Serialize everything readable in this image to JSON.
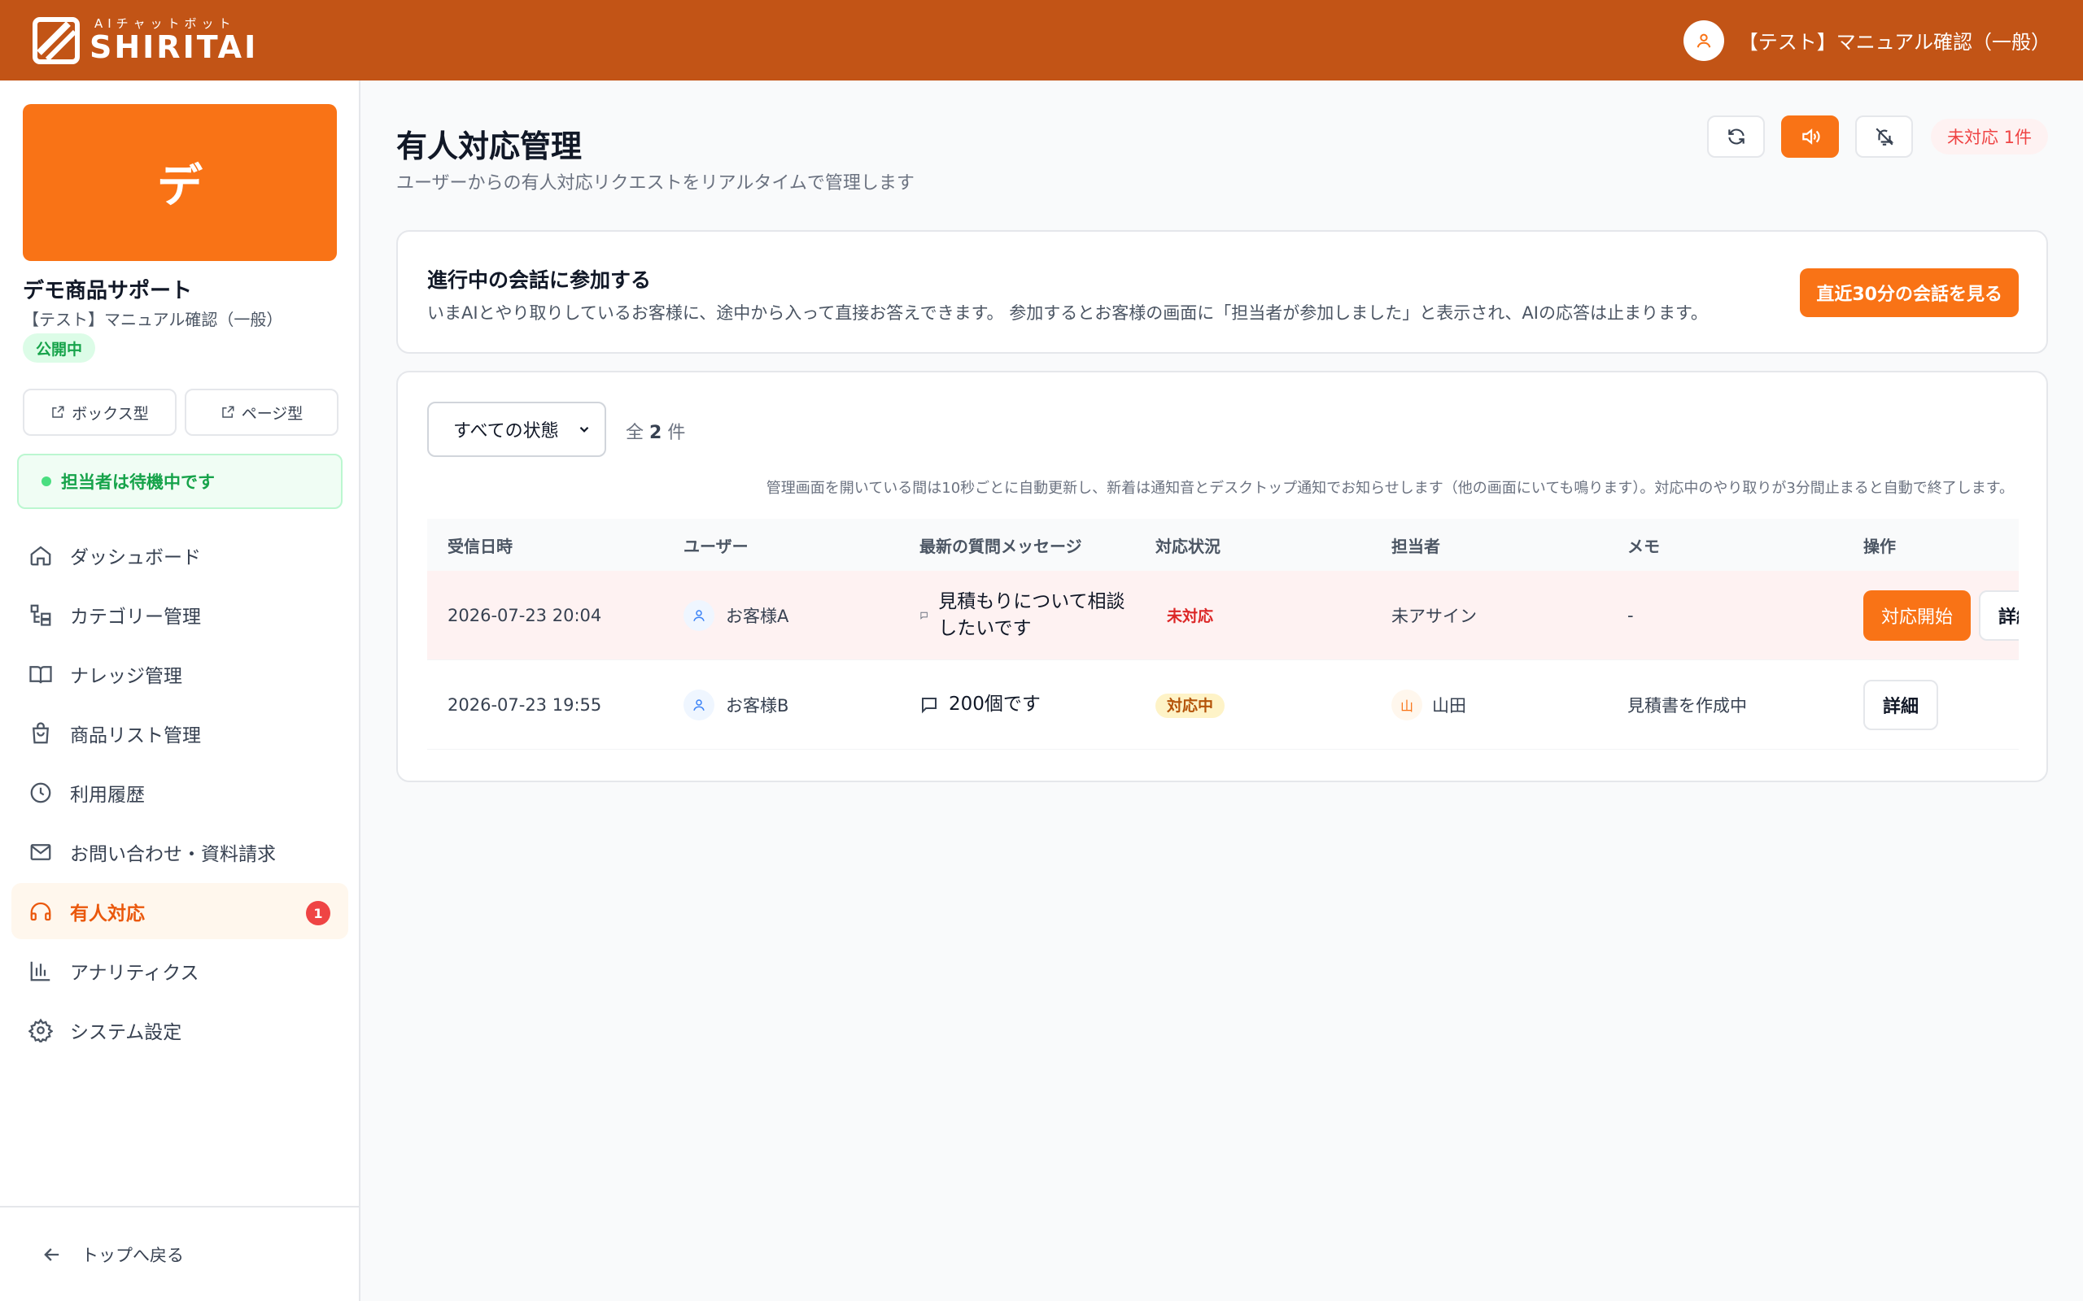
{
  "header": {
    "logo_sub": "AIチャットボット",
    "logo_main": "SHIRITAI",
    "user_name": "【テスト】マニュアル確認（一般）"
  },
  "sidebar": {
    "banner_char": "デ",
    "shop_name": "デモ商品サポート",
    "account": "【テスト】マニュアル確認（一般）",
    "public_badge": "公開中",
    "box_type": "ボックス型",
    "page_type": "ページ型",
    "staff_status": "担当者は待機中です",
    "items": [
      {
        "label": "ダッシュボード",
        "icon": "home-icon"
      },
      {
        "label": "カテゴリー管理",
        "icon": "category-icon"
      },
      {
        "label": "ナレッジ管理",
        "icon": "book-icon"
      },
      {
        "label": "商品リスト管理",
        "icon": "shopping-bag-icon"
      },
      {
        "label": "利用履歴",
        "icon": "clock-icon"
      },
      {
        "label": "お問い合わせ・資料請求",
        "icon": "mail-icon"
      },
      {
        "label": "有人対応",
        "icon": "headset-icon",
        "badge": "1",
        "active": true
      },
      {
        "label": "アナリティクス",
        "icon": "bar-chart-icon"
      },
      {
        "label": "システム設定",
        "icon": "gear-icon"
      }
    ],
    "back_label": "トップへ戻る"
  },
  "page": {
    "title": "有人対応管理",
    "subtitle": "ユーザーからの有人対応リクエストをリアルタイムで管理します",
    "pending_label": "未対応 1件"
  },
  "join": {
    "title": "進行中の会話に参加する",
    "description": "いまAIとやり取りしているお客様に、途中から入って直接お答えできます。 参加するとお客様の画面に「担当者が参加しました」と表示され、AIの応答は止まります。",
    "button": "直近30分の会話を見る"
  },
  "list": {
    "filter_value": "すべての状態",
    "total_prefix": "全",
    "total_count": "2",
    "total_suffix": "件",
    "notice": "管理画面を開いている間は10秒ごとに自動更新し、新着は通知音とデスクトップ通知でお知らせします（他の画面にいても鳴ります）。対応中のやり取りが3分間止まると自動で終了します。",
    "columns": [
      "受信日時",
      "ユーザー",
      "最新の質問メッセージ",
      "対応状況",
      "担当者",
      "メモ",
      "操作"
    ],
    "rows": [
      {
        "time": "2026-07-23 20:04",
        "user": "お客様A",
        "message": "見積もりについて相談したいです",
        "status": "未対応",
        "assignee": "未アサイン",
        "memo": "-",
        "action_primary": "対応開始",
        "action_detail": "詳細"
      },
      {
        "time": "2026-07-23 19:55",
        "user": "お客様B",
        "message": "200個です",
        "status": "対応中",
        "assignee_initial": "山",
        "assignee": "山田",
        "memo": "見積書を作成中",
        "action_detail": "詳細"
      }
    ]
  },
  "colors": {
    "header": "#c25416",
    "accent": "#f97316",
    "danger": "#ef4444",
    "success": "#16a34a"
  }
}
